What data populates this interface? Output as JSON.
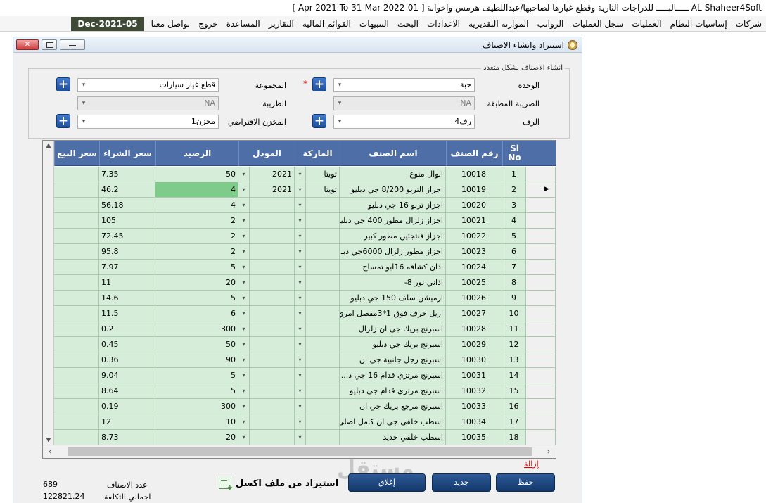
{
  "app_title": "AL-Shaheer4Soft ـــــالبـــــ للدراجات النارية وقطع غيارها لصاحبها/عبداللطيف هرمس واخوانة [ 01-Apr-2021 To 31-Mar-2022 ]",
  "menu": {
    "items": [
      "شركات",
      "إساسيات النظام",
      "العمليات",
      "سجل العمليات",
      "الرواتب",
      "الموازنة التقديرية",
      "الاعدادات",
      "البحث",
      "التنبيهات",
      "القوائم المالية",
      "التقارير",
      "المساعدة",
      "خروج",
      "تواصل معنا"
    ],
    "date": "Dec-2021-05"
  },
  "window": {
    "title": "استيراد وانشاء الاصناف",
    "close_label": "✕"
  },
  "form": {
    "legend": "انشاء الاصناف بشكل متعدد",
    "unit_label": "الوحده",
    "unit_value": "حبة",
    "group_label": "المجموعة",
    "group_value": "قطع غيار سيارات",
    "applied_tax_label": "الضريبة المطبقة",
    "applied_tax_value": "NA",
    "tax_label": "الظريبة",
    "tax_value": "NA",
    "shelf_label": "الرف",
    "shelf_value": "رف4",
    "warehouse_label": "المخزن الافتراضي",
    "warehouse_value": "مخزن1",
    "required_mark": "*"
  },
  "grid": {
    "columns": {
      "sl_no": "Sl No",
      "item_no": "رقم الصنف",
      "item_name": "اسم الصنف",
      "brand": "الماركة",
      "model": "المودل",
      "balance": "الرصيد",
      "purchase_price": "سعر الشراء",
      "sale_price": "سعر البيع"
    },
    "rows": [
      {
        "sl": "1",
        "no": "10018",
        "name": "ابوال منوع",
        "brand": "تويتا",
        "model": "2021",
        "balance": "50",
        "purchase": "7.35",
        "sale": ""
      },
      {
        "sl": "2",
        "no": "10019",
        "name": "اجزاز التربو 8/200 جي دبليو",
        "brand": "تويتا",
        "model": "2021",
        "balance": "4",
        "purchase": "46.2",
        "sale": ""
      },
      {
        "sl": "3",
        "no": "10020",
        "name": "اجزاز تربو 16 جي دبليو",
        "brand": "",
        "model": "",
        "balance": "4",
        "purchase": "56.18",
        "sale": ""
      },
      {
        "sl": "4",
        "no": "10021",
        "name": "اجزاز زلزال مطور 400 جي دبليو",
        "brand": "",
        "model": "",
        "balance": "2",
        "purchase": "105",
        "sale": ""
      },
      {
        "sl": "5",
        "no": "10022",
        "name": "اجزاز فنتجئين مطور كبير",
        "brand": "",
        "model": "",
        "balance": "2",
        "purchase": "72.45",
        "sale": ""
      },
      {
        "sl": "6",
        "no": "10023",
        "name": "اجزاز مطور زلزال 6000جي دبـ...",
        "brand": "",
        "model": "",
        "balance": "2",
        "purchase": "95.8",
        "sale": ""
      },
      {
        "sl": "7",
        "no": "10024",
        "name": "اذان كشافه 16ابو تمساح",
        "brand": "",
        "model": "",
        "balance": "5",
        "purchase": "7.97",
        "sale": ""
      },
      {
        "sl": "8",
        "no": "10025",
        "name": "اذاني نور 8-",
        "brand": "",
        "model": "",
        "balance": "20",
        "purchase": "11",
        "sale": ""
      },
      {
        "sl": "9",
        "no": "10026",
        "name": "ارميشن سلف 150 جي دبليو",
        "brand": "",
        "model": "",
        "balance": "5",
        "purchase": "14.6",
        "sale": ""
      },
      {
        "sl": "10",
        "no": "10027",
        "name": "اريل حرف فوق 1*3مفصل امري",
        "brand": "",
        "model": "",
        "balance": "6",
        "purchase": "11.5",
        "sale": ""
      },
      {
        "sl": "11",
        "no": "10028",
        "name": "اسبرنج بريك جي ان زلزال",
        "brand": "",
        "model": "",
        "balance": "300",
        "purchase": "0.2",
        "sale": ""
      },
      {
        "sl": "12",
        "no": "10029",
        "name": "اسبرنج بريك جي دبليو",
        "brand": "",
        "model": "",
        "balance": "50",
        "purchase": "0.45",
        "sale": ""
      },
      {
        "sl": "13",
        "no": "10030",
        "name": "اسبرنج رجل جانبية جي ان",
        "brand": "",
        "model": "",
        "balance": "90",
        "purchase": "0.36",
        "sale": ""
      },
      {
        "sl": "14",
        "no": "10031",
        "name": "اسبرنج مرتزي قدام 16 جي د...",
        "brand": "",
        "model": "",
        "balance": "5",
        "purchase": "9.04",
        "sale": ""
      },
      {
        "sl": "15",
        "no": "10032",
        "name": "اسبرنج مرتزي قدام جي دبليو",
        "brand": "",
        "model": "",
        "balance": "5",
        "purchase": "8.64",
        "sale": ""
      },
      {
        "sl": "16",
        "no": "10033",
        "name": "اسبرنج مرجع بريك جي ان",
        "brand": "",
        "model": "",
        "balance": "300",
        "purchase": "0.19",
        "sale": ""
      },
      {
        "sl": "17",
        "no": "10034",
        "name": "اسطب خلفي جي ان كامل اصلي",
        "brand": "",
        "model": "",
        "balance": "10",
        "purchase": "12",
        "sale": ""
      },
      {
        "sl": "18",
        "no": "10035",
        "name": "اسطب خلفي حديد",
        "brand": "",
        "model": "",
        "balance": "20",
        "purchase": "8.73",
        "sale": ""
      }
    ],
    "selected_row": "2"
  },
  "actions": {
    "remove_label": "إزالة",
    "save_label": "حفظ",
    "new_label": "جديد",
    "close_label": "إغلاق",
    "import_excel_label": "استيراد من ملف اكسل"
  },
  "stats": {
    "items_count_label": "عدد الاصناف",
    "items_count_value": "689",
    "total_cost_label": "اجمالي التكلفة",
    "total_cost_value": "122821.24"
  },
  "watermark": {
    "arabic": "مستقل",
    "latin": "mostaql.com"
  },
  "colors": {
    "grid_header": "#4e6ea8",
    "grid_cell": "#d6eed9",
    "selected_cell": "#7ecb8a",
    "menu_date_bg": "#3e4a36",
    "button": "#1f4781"
  }
}
